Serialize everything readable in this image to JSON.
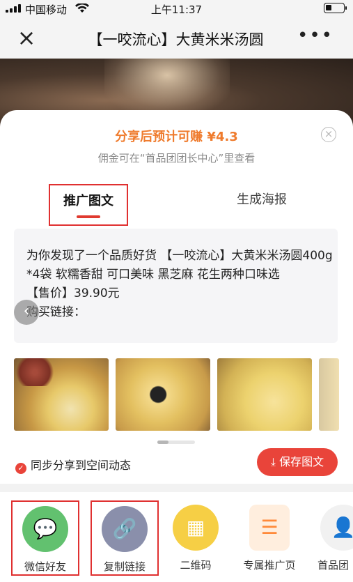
{
  "status": {
    "carrier": "中国移动",
    "time": "上午11:37"
  },
  "nav": {
    "title": "【一咬流心】大黄米米汤圆"
  },
  "earn": {
    "headline": "分享后预计可赚 ¥4.3",
    "sub": "佣金可在“首品团团长中心”里查看"
  },
  "tabs": [
    {
      "label": "推广图文",
      "active": true
    },
    {
      "label": "生成海报",
      "active": false
    }
  ],
  "promo_text": [
    "为你发现了一个品质好货 【一咬流心】大黄米米汤圆400g*4袋 软糯香甜 可口美味 黑芝麻 花生两种口味选",
    "【售价】39.90元",
    "购买链接："
  ],
  "actions": {
    "sync_label": "同步分享到空间动态",
    "save_label": "保存图文"
  },
  "share_options": [
    {
      "label": "微信好友",
      "icon": "wechat-icon",
      "color": "#62c16f"
    },
    {
      "label": "复制链接",
      "icon": "link-icon",
      "color": "#8a8fab"
    },
    {
      "label": "二维码",
      "icon": "qrcode-icon",
      "color": "#f6cf45"
    },
    {
      "label": "专属推广页",
      "icon": "promo-page-icon",
      "color": "#ff8a3a"
    },
    {
      "label": "首品团",
      "icon": "user-icon",
      "color": "#f1f1f1"
    }
  ],
  "colors": {
    "accent": "#e9443a",
    "earn": "#ef7b2d"
  }
}
